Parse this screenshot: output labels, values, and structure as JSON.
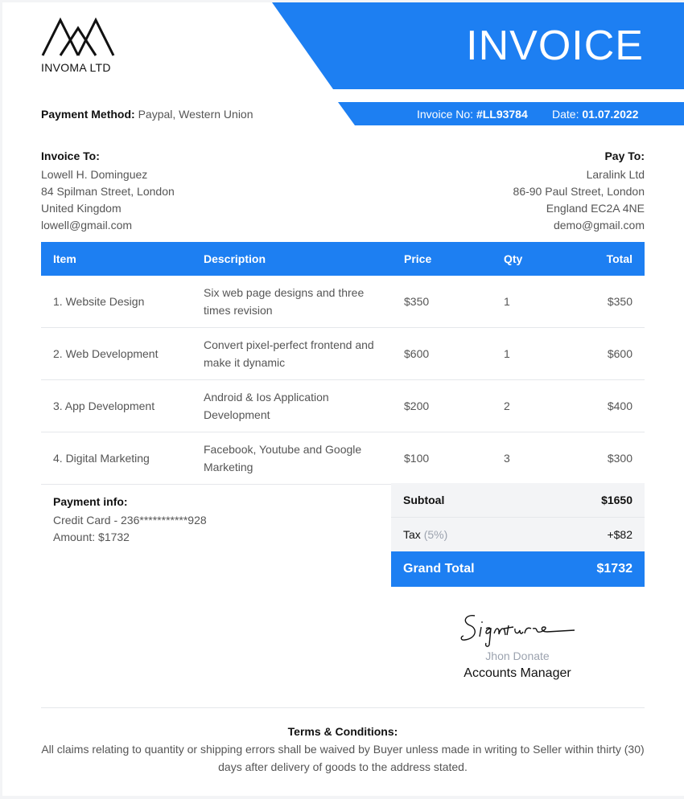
{
  "company": {
    "name": "INVOMA LTD"
  },
  "header": {
    "title": "INVOICE"
  },
  "payment_method": {
    "label": "Payment Method:",
    "value": "Paypal, Western Union"
  },
  "invoice_meta": {
    "no_label": "Invoice No:",
    "no_value": "#LL93784",
    "date_label": "Date:",
    "date_value": "01.07.2022"
  },
  "invoice_to": {
    "heading": "Invoice To:",
    "lines": [
      "Lowell H. Dominguez",
      "84 Spilman Street, London",
      "United Kingdom",
      "lowell@gmail.com"
    ]
  },
  "pay_to": {
    "heading": "Pay To:",
    "lines": [
      "Laralink Ltd",
      "86-90 Paul Street, London",
      "England EC2A 4NE",
      "demo@gmail.com"
    ]
  },
  "table": {
    "headers": [
      "Item",
      "Description",
      "Price",
      "Qty",
      "Total"
    ],
    "rows": [
      {
        "item": "1. Website Design",
        "desc": "Six web page designs and three times revision",
        "price": "$350",
        "qty": "1",
        "total": "$350"
      },
      {
        "item": "2. Web Development",
        "desc": "Convert pixel-perfect frontend and make it dynamic",
        "price": "$600",
        "qty": "1",
        "total": "$600"
      },
      {
        "item": "3. App Development",
        "desc": "Android & Ios Application Development",
        "price": "$200",
        "qty": "2",
        "total": "$400"
      },
      {
        "item": "4. Digital Marketing",
        "desc": "Facebook, Youtube and Google Marketing",
        "price": "$100",
        "qty": "3",
        "total": "$300"
      }
    ]
  },
  "payment_info": {
    "heading": "Payment info:",
    "card": "Credit Card - 236***********928",
    "amount": "Amount: $1732"
  },
  "summary": {
    "subtotal_label": "Subtoal",
    "subtotal_value": "$1650",
    "tax_label": "Tax",
    "tax_pct": "(5%)",
    "tax_value": "+$82",
    "grand_label": "Grand Total",
    "grand_value": "$1732"
  },
  "signature": {
    "script": "Signature",
    "name": "Jhon Donate",
    "role": "Accounts Manager"
  },
  "terms": {
    "heading": "Terms & Conditions:",
    "text": "All claims relating to quantity or shipping errors shall be waived by Buyer unless made in writing to Seller within thirty (30) days after delivery of goods to the address stated."
  },
  "colors": {
    "accent": "#1d7ff2",
    "muted": "#555555",
    "light_bg": "#f3f4f6"
  }
}
